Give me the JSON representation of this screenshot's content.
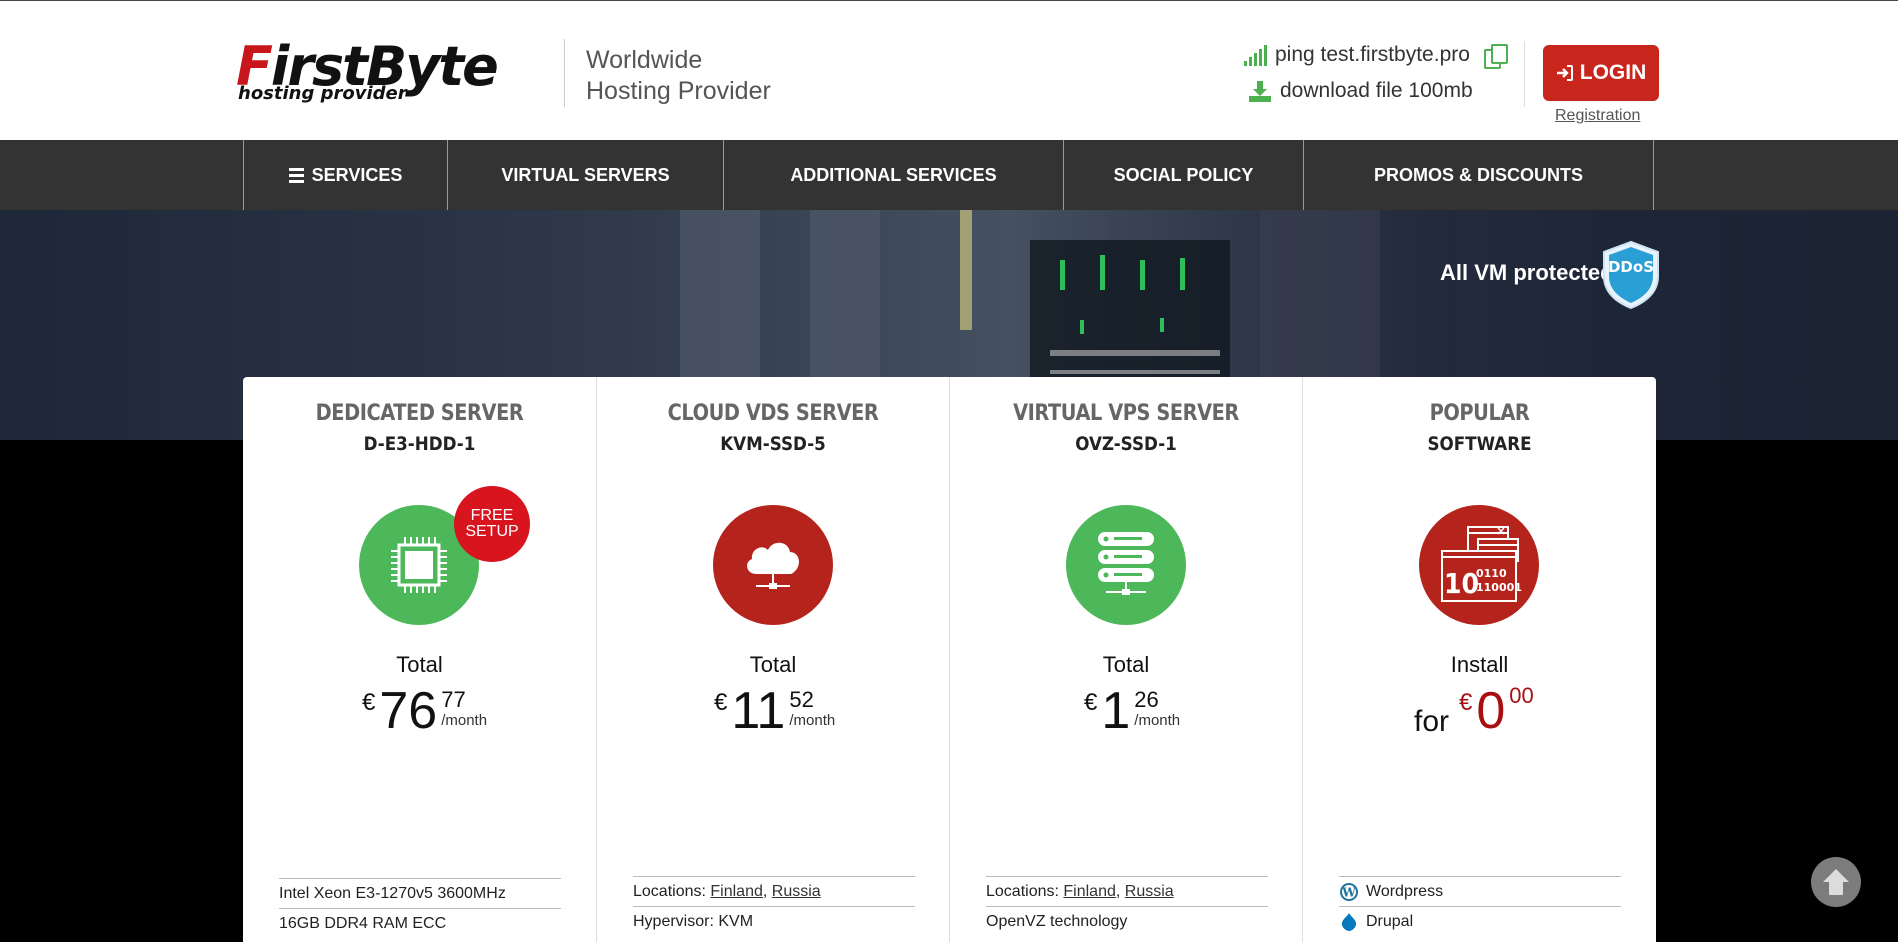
{
  "header": {
    "logo_text_1": "F",
    "logo_text_2": "irst",
    "logo_text_3": "Byte",
    "logo_sub": "hosting provider",
    "tagline_line1": "Worldwide",
    "tagline_line2": "Hosting Provider",
    "ping_label": "ping test.firstbyte.pro",
    "download_label": "download file 100mb",
    "login_label": "LOGIN",
    "registration_label": "Registration"
  },
  "nav": {
    "items": [
      {
        "label": "SERVICES"
      },
      {
        "label": "VIRTUAL SERVERS"
      },
      {
        "label": "ADDITIONAL SERVICES"
      },
      {
        "label": "SOCIAL POLICY"
      },
      {
        "label": "PROMOS & DISCOUNTS"
      }
    ]
  },
  "hero": {
    "ddos_text": "All VM protected",
    "ddos_badge": "DDoS"
  },
  "cards": [
    {
      "title": "DEDICATED SERVER",
      "subtitle": "D-E3-HDD-1",
      "badge_line1": "FREE",
      "badge_line2": "SETUP",
      "total_label": "Total",
      "currency": "€",
      "price_int": "76",
      "price_cents": "77",
      "per": "/month",
      "specs": [
        "Intel Xeon E3-1270v5 3600MHz",
        "16GB DDR4 RAM ECC"
      ]
    },
    {
      "title": "CLOUD VDS SERVER",
      "subtitle": "KVM-SSD-5",
      "total_label": "Total",
      "currency": "€",
      "price_int": "11",
      "price_cents": "52",
      "per": "/month",
      "locations_label": "Locations:",
      "loc1": "Finland",
      "loc_sep": ",",
      "loc2": "Russia",
      "spec2": "Hypervisor: KVM"
    },
    {
      "title": "VIRTUAL VPS SERVER",
      "subtitle": "OVZ-SSD-1",
      "total_label": "Total",
      "currency": "€",
      "price_int": "1",
      "price_cents": "26",
      "per": "/month",
      "locations_label": "Locations:",
      "loc1": "Finland",
      "loc_sep": ",",
      "loc2": "Russia",
      "spec2": "OpenVZ technology"
    },
    {
      "title": "POPULAR",
      "subtitle": "SOFTWARE",
      "total_label": "Install",
      "for_label": "for",
      "currency": "€",
      "price_int": "0",
      "price_cents": "00",
      "icon_text_1": "10",
      "icon_text_2": "0110",
      "icon_text_3": "110001",
      "software": [
        "Wordpress",
        "Drupal"
      ]
    }
  ],
  "colors": {
    "accent_red": "#c8261c",
    "accent_green": "#4db85a",
    "nav_bg": "#333333"
  }
}
